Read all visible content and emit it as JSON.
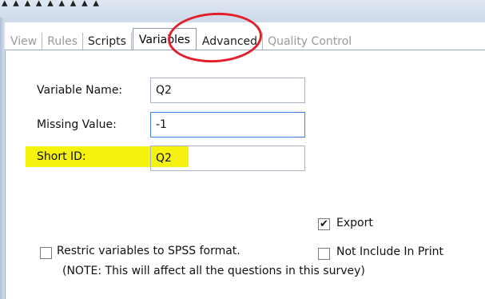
{
  "tabs": [
    {
      "label": "View",
      "state": "disabled"
    },
    {
      "label": "Rules",
      "state": "disabled"
    },
    {
      "label": "Scripts",
      "state": "enabled"
    },
    {
      "label": "Variables",
      "state": "active"
    },
    {
      "label": "Advanced",
      "state": "enabled"
    },
    {
      "label": "Quality Control",
      "state": "disabled"
    }
  ],
  "form": {
    "variable_name_label": "Variable Name:",
    "variable_name_value": "Q2",
    "missing_value_label": "Missing Value:",
    "missing_value_value": "-1",
    "short_id_label": "Short ID:",
    "short_id_value": "Q2"
  },
  "options": {
    "export_label": "Export",
    "export_checked": true,
    "restrict_label": "Restric variables to SPSS format.",
    "restrict_checked": false,
    "restrict_note": "(NOTE: This will affect all the questions in this survey)",
    "not_include_label": "Not Include In Print",
    "not_include_checked": false
  },
  "colors": {
    "highlight": "#f4f20e",
    "annotation_circle": "#e0202a",
    "focus_border": "#3f80d8"
  }
}
